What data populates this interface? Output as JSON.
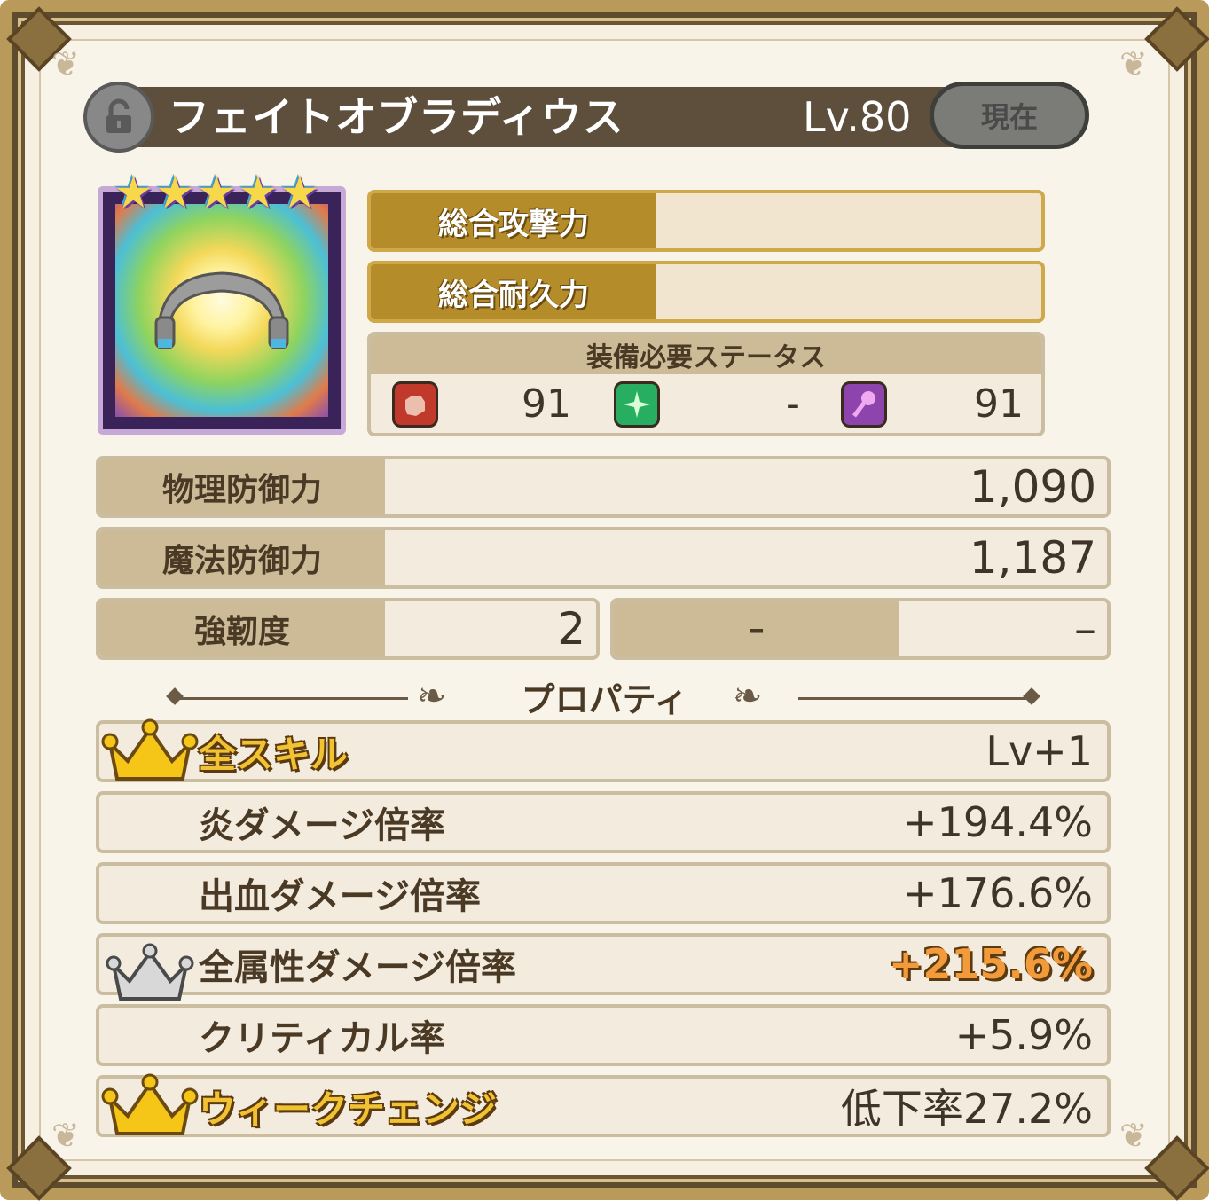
{
  "item": {
    "name": "フェイトオブラディウス",
    "level": "Lv.80",
    "current_button": "現在",
    "stars": 5
  },
  "totals": {
    "attack_label": "総合攻撃力",
    "defense_label": "総合耐久力"
  },
  "requirements": {
    "title": "装備必要ステータス",
    "items": [
      {
        "icon": "fist-icon",
        "value": "91",
        "color": "#c0392b"
      },
      {
        "icon": "agility-icon",
        "value": "-",
        "color": "#27ae60"
      },
      {
        "icon": "magic-icon",
        "value": "91",
        "color": "#8e44ad"
      }
    ]
  },
  "stats": {
    "phys_def_label": "物理防御力",
    "phys_def_value": "1,090",
    "mag_def_label": "魔法防御力",
    "mag_def_value": "1,187",
    "tough_label": "強靭度",
    "tough_value": "2",
    "extra_label": "–",
    "extra_value": "–"
  },
  "properties": {
    "title": "プロパティ",
    "rows": [
      {
        "label": "全スキル",
        "value": "Lv+1",
        "crown": "gold"
      },
      {
        "label": "炎ダメージ倍率",
        "value": "+194.4%",
        "crown": "none"
      },
      {
        "label": "出血ダメージ倍率",
        "value": "+176.6%",
        "crown": "none"
      },
      {
        "label": "全属性ダメージ倍率",
        "value": "+215.6%",
        "crown": "silver"
      },
      {
        "label": "クリティカル率",
        "value": "+5.9%",
        "crown": "none"
      },
      {
        "label": "ウィークチェンジ",
        "value": "低下率27.2%",
        "crown": "gold"
      }
    ]
  }
}
